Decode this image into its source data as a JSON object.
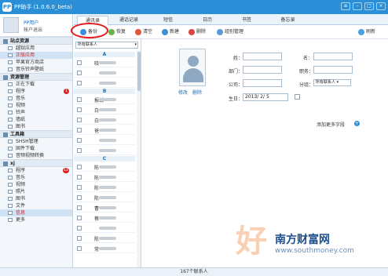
{
  "window": {
    "title": "PP助手 (1.0.6.0_beta)"
  },
  "user": {
    "name": "PP用户",
    "logout": "帐户退出"
  },
  "sidebar": {
    "groups": [
      {
        "title": "站点资源",
        "items": [
          {
            "label": "越狱应用"
          },
          {
            "label": "正版应用",
            "active": true
          },
          {
            "label": "苹果官方商店"
          },
          {
            "label": "音乐铃声壁纸"
          }
        ]
      },
      {
        "title": "资源管理",
        "items": [
          {
            "label": "正在下载"
          },
          {
            "label": "程序",
            "badge": "1"
          },
          {
            "label": "音乐"
          },
          {
            "label": "视频"
          },
          {
            "label": "铃声"
          },
          {
            "label": "墙纸"
          },
          {
            "label": "图书"
          }
        ]
      },
      {
        "title": "工具箱",
        "items": [
          {
            "label": "SHSH管理"
          },
          {
            "label": "固件下载"
          },
          {
            "label": "音频视频转换"
          }
        ]
      },
      {
        "title": "xj",
        "items": [
          {
            "label": "程序",
            "badge": "12"
          },
          {
            "label": "音乐"
          },
          {
            "label": "视频"
          },
          {
            "label": "照片"
          },
          {
            "label": "图书"
          },
          {
            "label": "文件"
          },
          {
            "label": "信息",
            "active": true
          },
          {
            "label": "更多"
          }
        ]
      }
    ]
  },
  "tabs": [
    {
      "label": "通讯录",
      "active": true
    },
    {
      "label": "通话记录"
    },
    {
      "label": "短信"
    },
    {
      "label": "日历"
    },
    {
      "label": "书签"
    },
    {
      "label": "备忘录"
    }
  ],
  "toolbar": {
    "backup": "备份",
    "restore": "恢复",
    "clear": "清空",
    "new": "新建",
    "delete": "删除",
    "group": "组别管理",
    "refresh": "刷新"
  },
  "contacts": {
    "filter": "所有联系人",
    "sections": [
      {
        "letter": "A",
        "names": [
          "晓",
          "",
          ""
        ]
      },
      {
        "letter": "B",
        "names": [
          "报纸",
          "白",
          "白",
          "爸",
          "",
          ""
        ]
      },
      {
        "letter": "C",
        "names": [
          "陈",
          "陈",
          "陈",
          "陈",
          "曹",
          "蔡",
          "",
          "陈",
          "常"
        ]
      }
    ]
  },
  "detail": {
    "edit": "修改",
    "delete": "删除",
    "fields": {
      "surname": "姓：",
      "given": "名：",
      "department": "部门：",
      "title": "职务：",
      "company": "公司：",
      "group": "分组：",
      "group_value": "所有联系人",
      "birthday": "生日：",
      "birthday_value": "2013/ 2/ 5"
    },
    "add_more": "添加更多字段"
  },
  "status": {
    "count": "167个联系人"
  },
  "watermark": {
    "big": "好",
    "site": "南方财富网",
    "url": "www.southmoney.com"
  },
  "colors": {
    "accent": "#2a8fd6",
    "highlight": "#e41b1b"
  }
}
